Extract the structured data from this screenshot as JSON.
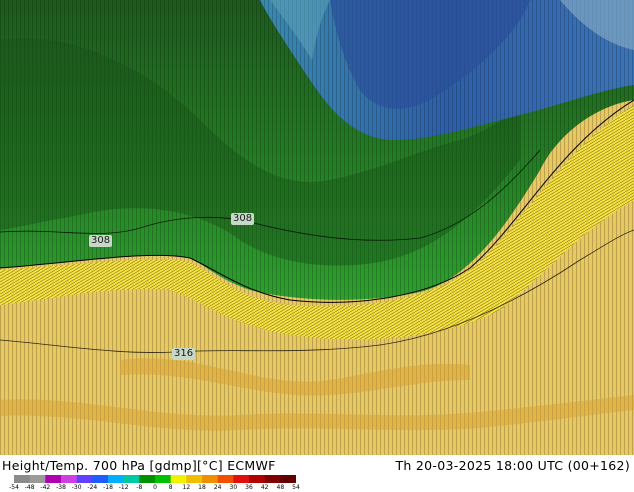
{
  "map": {
    "contour_labels": [
      "308",
      "308",
      "316"
    ]
  },
  "footer": {
    "title_left": "Height/Temp. 700 hPa [gdmp][°C] ECMWF",
    "title_right": "Th 20-03-2025 18:00 UTC (00+162)",
    "colorbar": {
      "ticks": [
        "-54",
        "-48",
        "-42",
        "-38",
        "-30",
        "-24",
        "-18",
        "-12",
        "-8",
        "0",
        "8",
        "12",
        "18",
        "24",
        "30",
        "36",
        "42",
        "48",
        "54"
      ],
      "colors": [
        "#8a8a8a",
        "#9a9a9a",
        "#b000b0",
        "#d040e0",
        "#6040ff",
        "#1e5cff",
        "#00b0ff",
        "#00c8a0",
        "#009000",
        "#00c000",
        "#f0f000",
        "#f0c000",
        "#f09000",
        "#f05000",
        "#e01010",
        "#b00000",
        "#800000",
        "#600000"
      ]
    }
  }
}
